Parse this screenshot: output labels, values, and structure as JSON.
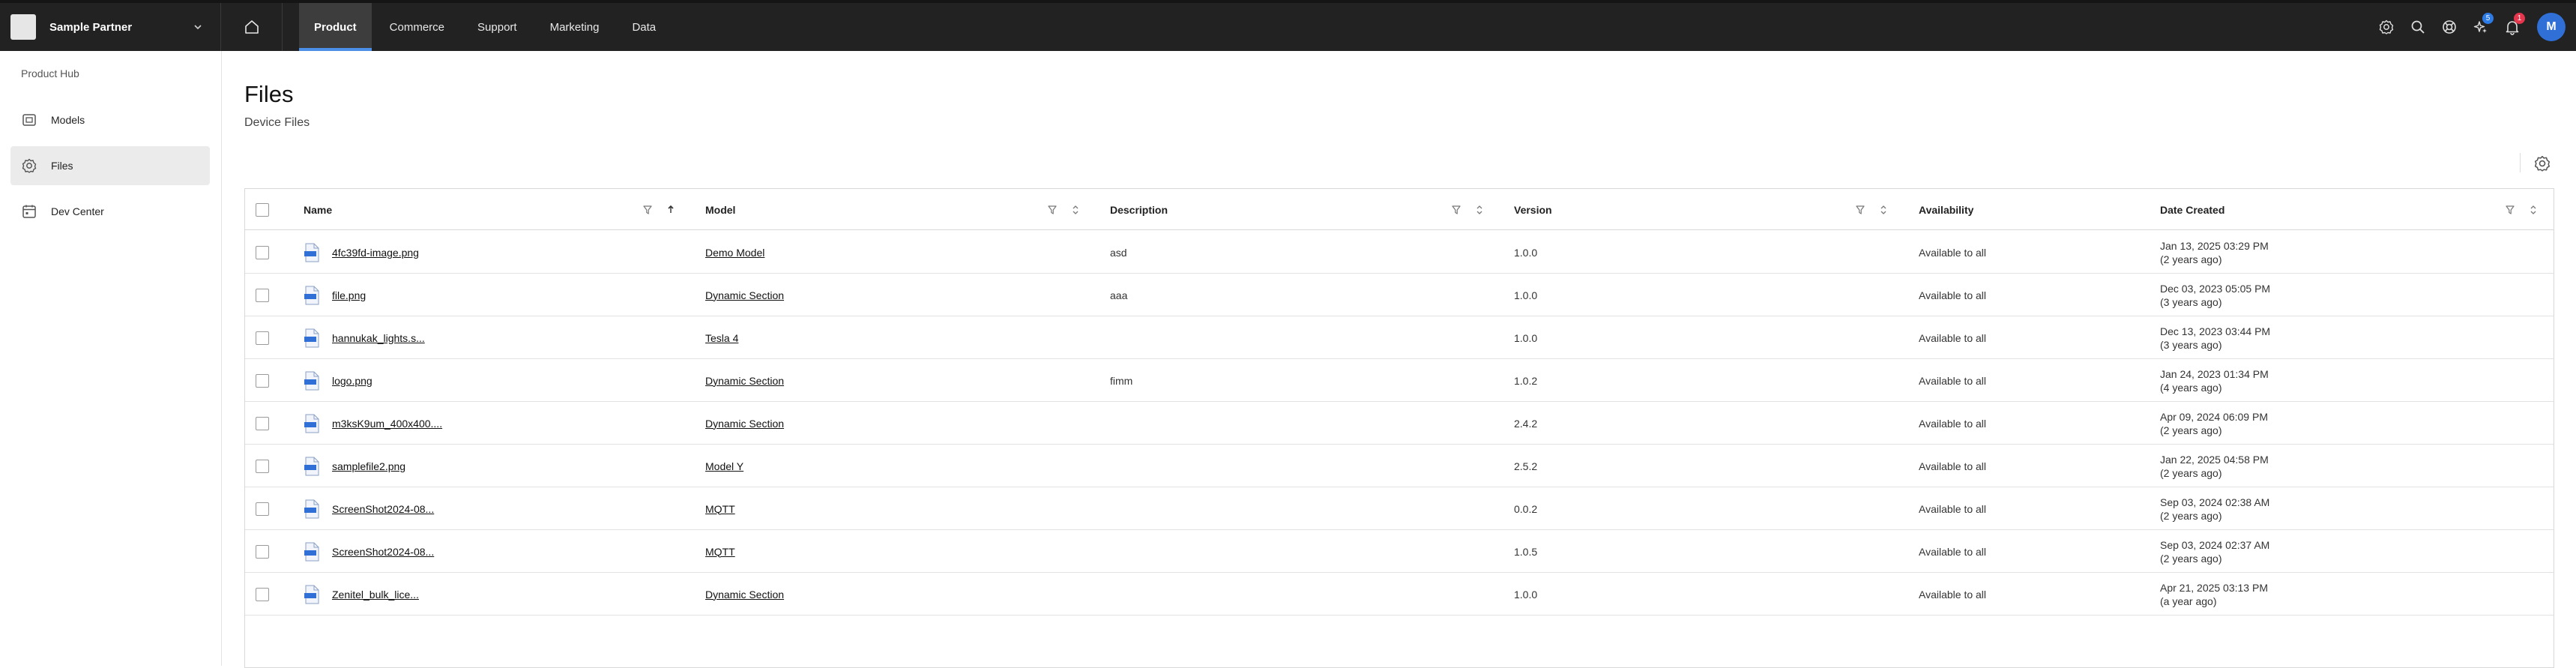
{
  "header": {
    "org_name": "Sample Partner",
    "nav": [
      {
        "label": "Product",
        "active": true
      },
      {
        "label": "Commerce",
        "active": false
      },
      {
        "label": "Support",
        "active": false
      },
      {
        "label": "Marketing",
        "active": false
      },
      {
        "label": "Data",
        "active": false
      }
    ],
    "ai_badge": "5",
    "notifications_badge": "1",
    "avatar_initial": "M"
  },
  "sidebar": {
    "title": "Product Hub",
    "items": [
      {
        "label": "Models",
        "icon": "cube-icon",
        "active": false
      },
      {
        "label": "Files",
        "icon": "gear-icon",
        "active": true
      },
      {
        "label": "Dev Center",
        "icon": "calendar-icon",
        "active": false
      }
    ]
  },
  "page": {
    "title": "Files",
    "subtitle": "Device Files"
  },
  "table": {
    "columns": [
      "Name",
      "Model",
      "Description",
      "Version",
      "Availability",
      "Date Created"
    ],
    "rows": [
      {
        "name": "4fc39fd-image.png",
        "model": "Demo Model",
        "description": "asd",
        "version": "1.0.0",
        "availability": "Available to all",
        "date": "Jan 13, 2025 03:29 PM",
        "ago": "(2 years ago)"
      },
      {
        "name": "file.png",
        "model": "Dynamic Section",
        "description": "aaa",
        "version": "1.0.0",
        "availability": "Available to all",
        "date": "Dec 03, 2023 05:05 PM",
        "ago": "(3 years ago)"
      },
      {
        "name": "hannukak_lights.s...",
        "model": "Tesla 4",
        "description": "",
        "version": "1.0.0",
        "availability": "Available to all",
        "date": "Dec 13, 2023 03:44 PM",
        "ago": "(3 years ago)"
      },
      {
        "name": "logo.png",
        "model": "Dynamic Section",
        "description": "fimm",
        "version": "1.0.2",
        "availability": "Available to all",
        "date": "Jan 24, 2023 01:34 PM",
        "ago": "(4 years ago)"
      },
      {
        "name": "m3ksK9um_400x400....",
        "model": "Dynamic Section",
        "description": "",
        "version": "2.4.2",
        "availability": "Available to all",
        "date": "Apr 09, 2024 06:09 PM",
        "ago": "(2 years ago)"
      },
      {
        "name": "samplefile2.png",
        "model": "Model Y",
        "description": "",
        "version": "2.5.2",
        "availability": "Available to all",
        "date": "Jan 22, 2025 04:58 PM",
        "ago": "(2 years ago)"
      },
      {
        "name": "ScreenShot2024-08...",
        "model": "MQTT",
        "description": "",
        "version": "0.0.2",
        "availability": "Available to all",
        "date": "Sep 03, 2024 02:38 AM",
        "ago": "(2 years ago)"
      },
      {
        "name": "ScreenShot2024-08...",
        "model": "MQTT",
        "description": "",
        "version": "1.0.5",
        "availability": "Available to all",
        "date": "Sep 03, 2024 02:37 AM",
        "ago": "(2 years ago)"
      },
      {
        "name": "Zenitel_bulk_lice...",
        "model": "Dynamic Section",
        "description": "",
        "version": "1.0.0",
        "availability": "Available to all",
        "date": "Apr 21, 2025 03:13 PM",
        "ago": "(a year ago)"
      }
    ]
  }
}
